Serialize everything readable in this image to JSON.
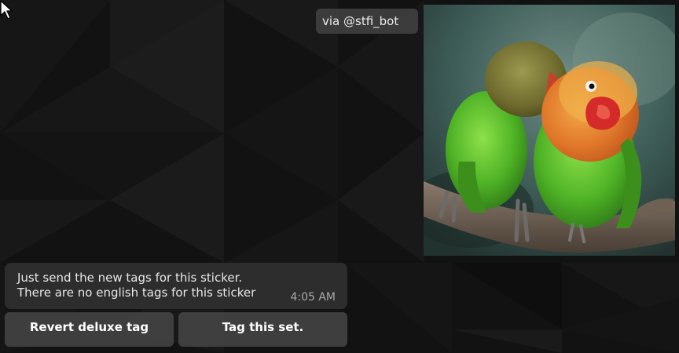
{
  "chat": {
    "via_label": "via @stfi_bot",
    "sticker_alt": "two lovebirds on a branch",
    "message": {
      "line1": "Just send the new tags for this sticker.",
      "line2": "There are no english tags for this sticker",
      "time": "4:05 AM"
    },
    "buttons": {
      "revert_label": "Revert deluxe tag",
      "tag_set_label": "Tag this set."
    }
  },
  "colors": {
    "background": "#121212",
    "bubble": "#2d2d2d",
    "button": "#4a4a4a",
    "text": "#e8e8e8"
  },
  "icons": {
    "cursor": "arrow-cursor-icon"
  }
}
